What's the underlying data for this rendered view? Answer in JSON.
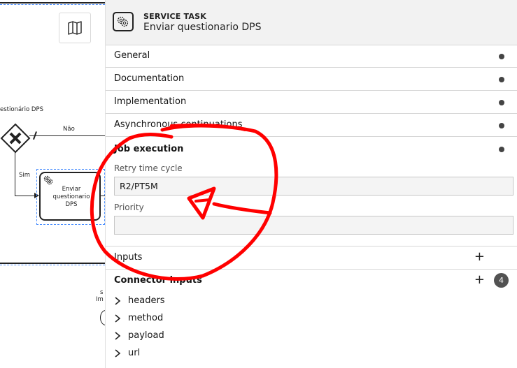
{
  "canvas": {
    "gateway_label": "estionário DPS",
    "flow_no_label": "Não",
    "flow_sim_label": "Sim",
    "task_name": "Enviar questionario DPS",
    "lower_text_1": "s",
    "lower_text_2": "Im"
  },
  "panel": {
    "header": {
      "type": "SERVICE TASK",
      "name": "Enviar questionario DPS"
    },
    "groups": [
      {
        "label": "General"
      },
      {
        "label": "Documentation"
      },
      {
        "label": "Implementation"
      },
      {
        "label": "Asynchronous continuations"
      }
    ],
    "job_execution": {
      "title": "Job execution",
      "retry_label": "Retry time cycle",
      "retry_value": "R2/PT5M",
      "priority_label": "Priority",
      "priority_value": ""
    },
    "inputs": {
      "label": "Inputs"
    },
    "connector_inputs": {
      "label": "Connector inputs",
      "count": "4",
      "items": [
        "headers",
        "method",
        "payload",
        "url"
      ]
    }
  },
  "colors": {
    "annotation": "#ff0000",
    "badge": "#525252",
    "selection": "#4d90fe"
  }
}
